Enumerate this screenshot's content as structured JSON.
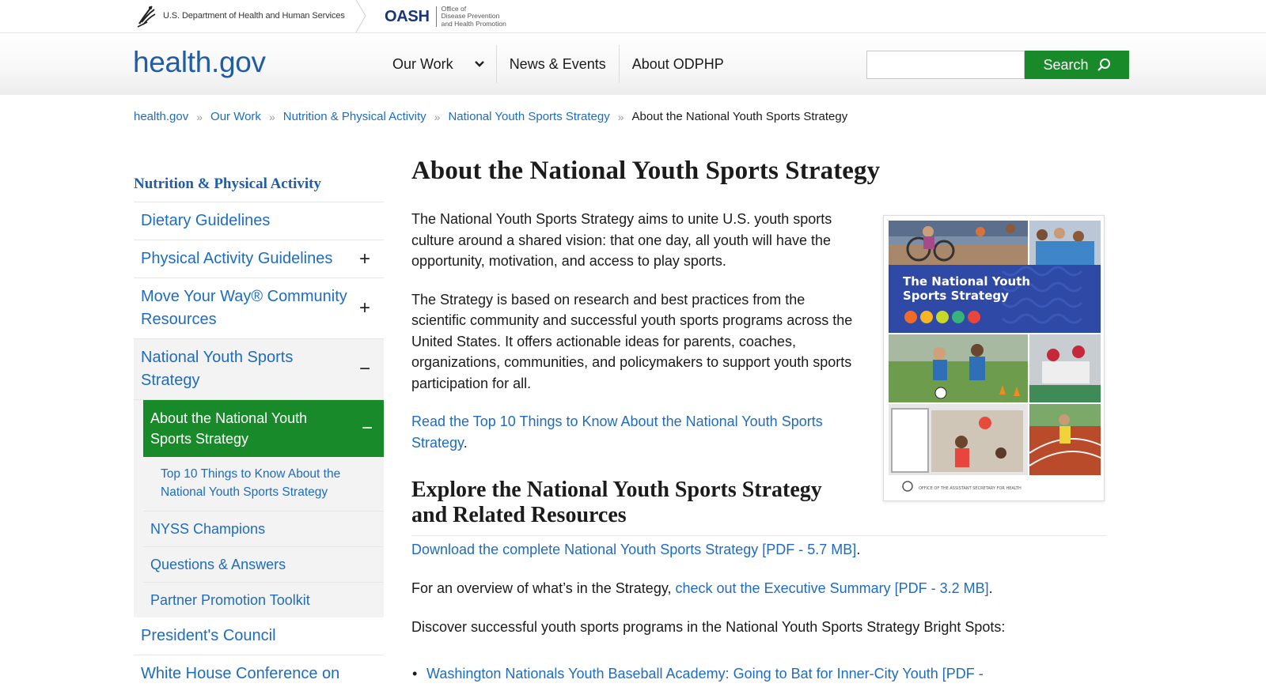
{
  "agency": {
    "hhs_text": "U.S. Department of Health and Human Services",
    "oash": "OASH",
    "oash_sub": [
      "Office of",
      "Disease Prevention",
      "and Health Promotion"
    ]
  },
  "header": {
    "logo": "health.gov",
    "nav": [
      {
        "label": "Our Work",
        "has_dropdown": true
      },
      {
        "label": "News & Events"
      },
      {
        "label": "About ODPHP"
      }
    ],
    "search": {
      "value": "",
      "button": "Search"
    }
  },
  "breadcrumb": {
    "links": [
      "health.gov",
      "Our Work",
      "Nutrition & Physical Activity",
      "National Youth Sports Strategy"
    ],
    "current": "About the National Youth Sports Strategy",
    "separator": "»"
  },
  "sidebar": {
    "title": "Nutrition & Physical Activity",
    "items": [
      {
        "label": "Dietary Guidelines",
        "toggle": ""
      },
      {
        "label": "Physical Activity Guidelines",
        "toggle": "+"
      },
      {
        "label": "Move Your Way® Community Resources",
        "toggle": "+"
      },
      {
        "label": "National Youth Sports Strategy",
        "toggle": "−"
      }
    ],
    "active": {
      "label": "About the National Youth Sports Strategy",
      "toggle": "−"
    },
    "active_child": "Top 10 Things to Know About the National Youth Sports Strategy",
    "subitems": [
      "NYSS Champions",
      "Questions & Answers",
      "Partner Promotion Toolkit"
    ],
    "after": [
      "President's Council",
      "White House Conference on"
    ]
  },
  "main": {
    "title": "About the National Youth Sports Strategy",
    "para1": "The National Youth Sports Strategy aims to unite U.S. youth sports culture around a shared vision: that one day, all youth will have the opportunity, motivation, and access to play sports.",
    "para2": "The Strategy is based on research and best practices from the scientific community and successful youth sports programs across the United States. It offers actionable ideas for parents, coaches, organizations, communities, and policymakers to support youth sports participation for all.",
    "top10_link": "Read the Top 10 Things to Know About the National Youth Sports Strategy",
    "top10_end": ".",
    "explore_heading": "Explore the National Youth Sports Strategy and Related Resources",
    "download_link": "Download the complete National Youth Sports Strategy [PDF - 5.7 MB]",
    "download_end": ".",
    "overview_text": "For an overview of what’s in the Strategy, ",
    "overview_link": "check out the Executive Summary [PDF - 3.2 MB]",
    "overview_end": ".",
    "discover_text": "Discover successful youth sports programs in the National Youth Sports Strategy Bright Spots:",
    "bullet_link": "Washington Nationals Youth Baseball Academy: Going to Bat for Inner-City Youth [PDF -"
  },
  "cover": {
    "title_line1": "The National Youth",
    "title_line2": "Sports Strategy",
    "footer": "OFFICE OF THE ASSISTANT SECRETARY FOR HEALTH"
  },
  "colors": {
    "brand_blue": "#1f5da8",
    "link_blue": "#1f6cbf",
    "accent_green": "#188a2a",
    "cover_blue": "#2e49a6"
  }
}
